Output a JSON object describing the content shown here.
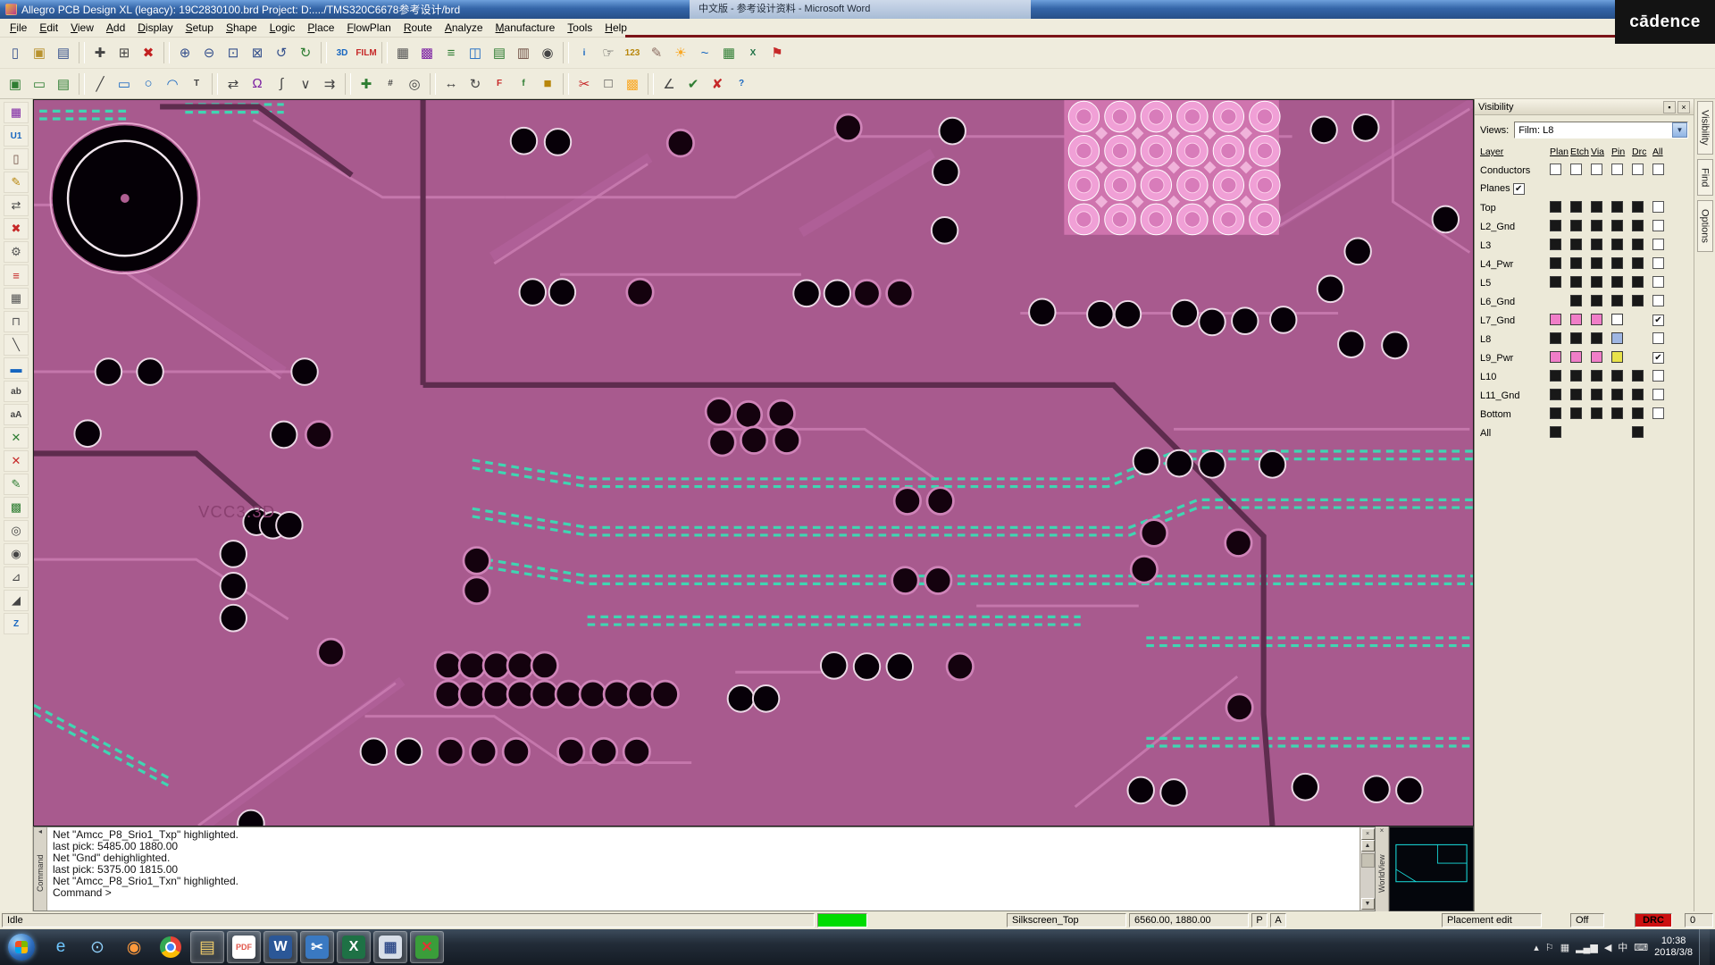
{
  "colors": {
    "canvas_bg": "#a85a8e",
    "teal": "#3fd6b2",
    "trace_light": "#ca7cb2",
    "trace_wide": "#b867a2",
    "trace_dark": "#5e2c4e",
    "pad_black": "#070008",
    "pad_ring_white": "#ecd8e6",
    "pad_ring_purple": "#cf84b8",
    "bga_base": "#cf74ae",
    "bga_pad": "#f0a0d6",
    "bga_inner": "#d87cba",
    "highlight_green": "#00dc00",
    "drc_red": "#cc1111"
  },
  "glyphs": {
    "close": "×",
    "pin": "▪",
    "dropdown": "▼",
    "check": "✔",
    "scroll_up": "▲",
    "scroll_down": "▼",
    "left_arrows": "◂"
  },
  "titlebar": {
    "title": "Allegro PCB Design XL (legacy): 19C2830100.brd  Project: D:..../TMS320C6678参考设计/brd",
    "background_window_title": "中文版 - 参考设计资料 - Microsoft Word",
    "brand_logo": "cādence"
  },
  "menubar": {
    "items": [
      "File",
      "Edit",
      "View",
      "Add",
      "Display",
      "Setup",
      "Shape",
      "Logic",
      "Place",
      "FlowPlan",
      "Route",
      "Analyze",
      "Manufacture",
      "Tools",
      "Help"
    ]
  },
  "toolbar_row1": [
    {
      "name": "new-icon",
      "glyph": "▯",
      "color": "#35508c"
    },
    {
      "name": "open-icon",
      "glyph": "▣",
      "color": "#b8922e"
    },
    {
      "name": "save-icon",
      "glyph": "▤",
      "color": "#35508c"
    },
    {
      "sep": true
    },
    {
      "name": "move-icon",
      "glyph": "✚",
      "color": "#444444"
    },
    {
      "name": "copy-icon",
      "glyph": "⊞",
      "color": "#444444"
    },
    {
      "name": "delete-icon",
      "glyph": "✖",
      "color": "#c22020"
    },
    {
      "sep": true
    },
    {
      "name": "zoom-in-icon",
      "glyph": "⊕",
      "color": "#35508c"
    },
    {
      "name": "zoom-out-icon",
      "glyph": "⊖",
      "color": "#35508c"
    },
    {
      "name": "zoom-by-points-icon",
      "glyph": "⊡",
      "color": "#35508c"
    },
    {
      "name": "zoom-fit-icon",
      "glyph": "⊠",
      "color": "#35508c"
    },
    {
      "name": "zoom-previous-icon",
      "glyph": "↺",
      "color": "#35508c"
    },
    {
      "name": "redraw-icon",
      "glyph": "↻",
      "color": "#2e7d32"
    },
    {
      "sep": true
    },
    {
      "name": "view-3d-icon",
      "glyph": "3D",
      "color": "#1565c0",
      "text": true
    },
    {
      "name": "film-icon",
      "glyph": "FILM",
      "color": "#c62828",
      "text": true
    },
    {
      "sep": true
    },
    {
      "name": "grid-toggle-icon",
      "glyph": "▦",
      "color": "#555555"
    },
    {
      "name": "color-dialog-icon",
      "glyph": "▩",
      "color": "#7b1fa2"
    },
    {
      "name": "cross-section-icon",
      "glyph": "≡",
      "color": "#2e7d32"
    },
    {
      "name": "padstack-icon",
      "glyph": "◫",
      "color": "#1565c0"
    },
    {
      "name": "constraint-mgr-icon",
      "glyph": "▤",
      "color": "#2e7d32"
    },
    {
      "name": "component-icon",
      "glyph": "▥",
      "color": "#6d4c41"
    },
    {
      "name": "pin-icon",
      "glyph": "◉",
      "color": "#444444"
    },
    {
      "sep": true
    },
    {
      "name": "info-icon",
      "glyph": "i",
      "color": "#1565c0",
      "text": true
    },
    {
      "name": "show-element-icon",
      "glyph": "☞",
      "color": "#444444"
    },
    {
      "name": "status-icon",
      "glyph": "123",
      "color": "#b8860b",
      "text": true
    },
    {
      "name": "measure-icon",
      "glyph": "✎",
      "color": "#8d6e63"
    },
    {
      "name": "highlight-icon",
      "glyph": "☀",
      "color": "#f9a825"
    },
    {
      "name": "waveform-icon",
      "glyph": "~",
      "color": "#1565c0"
    },
    {
      "name": "spreadsheet-icon",
      "glyph": "▦",
      "color": "#2e7d32"
    },
    {
      "name": "excel-icon",
      "glyph": "X",
      "color": "#1e7145",
      "text": true
    },
    {
      "name": "flag-icon",
      "glyph": "⚑",
      "color": "#c62828"
    }
  ],
  "toolbar_row2": [
    {
      "name": "board-green-icon",
      "glyph": "▣",
      "color": "#2e7d32"
    },
    {
      "name": "board-outline-icon",
      "glyph": "▭",
      "color": "#2e7d32"
    },
    {
      "name": "board-save-icon",
      "glyph": "▤",
      "color": "#2e7d32"
    },
    {
      "sep": true
    },
    {
      "name": "add-line-icon",
      "glyph": "╱",
      "color": "#444444"
    },
    {
      "name": "add-rect-icon",
      "glyph": "▭",
      "color": "#1565c0"
    },
    {
      "name": "add-circle-icon",
      "glyph": "○",
      "color": "#1565c0"
    },
    {
      "name": "add-arc-icon",
      "glyph": "◠",
      "color": "#1565c0"
    },
    {
      "name": "add-text-icon",
      "glyph": "T",
      "color": "#444444",
      "text": true
    },
    {
      "sep": true
    },
    {
      "name": "slide-icon",
      "glyph": "⇄",
      "color": "#444444"
    },
    {
      "name": "delay-tune-icon",
      "glyph": "Ω",
      "color": "#7b1fa2"
    },
    {
      "name": "custom-smooth-icon",
      "glyph": "∫",
      "color": "#444444"
    },
    {
      "name": "vertex-icon",
      "glyph": "∨",
      "color": "#444444"
    },
    {
      "name": "spread-icon",
      "glyph": "⇉",
      "color": "#444444"
    },
    {
      "sep": true
    },
    {
      "name": "route-connect-icon",
      "glyph": "✚",
      "color": "#2e7d32"
    },
    {
      "name": "fanout-icon",
      "glyph": "#",
      "color": "#444444",
      "text": true
    },
    {
      "name": "add-via-icon",
      "glyph": "◎",
      "color": "#444444"
    },
    {
      "sep": true
    },
    {
      "name": "mirror-icon",
      "glyph": "↔",
      "color": "#444444"
    },
    {
      "name": "spin-icon",
      "glyph": "↻",
      "color": "#444444"
    },
    {
      "name": "fix-icon",
      "glyph": "F",
      "color": "#c62828",
      "text": true
    },
    {
      "name": "unfix-icon",
      "glyph": "f",
      "color": "#2e7d32",
      "text": true
    },
    {
      "name": "lock-icon",
      "glyph": "■",
      "color": "#b8860b"
    },
    {
      "sep": true
    },
    {
      "name": "ripup-icon",
      "glyph": "✂",
      "color": "#c62828"
    },
    {
      "name": "dehighlight-icon",
      "glyph": "□",
      "color": "#444444"
    },
    {
      "name": "assign-color-icon",
      "glyph": "▩",
      "color": "#f9a825"
    },
    {
      "sep": true
    },
    {
      "name": "measure-angle-icon",
      "glyph": "∠",
      "color": "#444444"
    },
    {
      "name": "done-icon",
      "glyph": "✔",
      "color": "#2e7d32"
    },
    {
      "name": "cancel-icon",
      "glyph": "✘",
      "color": "#c62828"
    },
    {
      "name": "help-icon",
      "glyph": "?",
      "color": "#1565c0",
      "text": true
    }
  ],
  "left_toolbar": [
    {
      "name": "design-icon",
      "glyph": "▦",
      "color": "#7b1fa2"
    },
    {
      "name": "place-part-icon",
      "glyph": "U1",
      "color": "#1565c0",
      "text": true
    },
    {
      "name": "place-module-icon",
      "glyph": "▯",
      "color": "#6d4c41"
    },
    {
      "name": "etch-edit-icon",
      "glyph": "✎",
      "color": "#b8860b"
    },
    {
      "name": "slide-tool-icon",
      "glyph": "⇄",
      "color": "#444444"
    },
    {
      "name": "delete-tool-icon",
      "glyph": "✖",
      "color": "#c62828"
    },
    {
      "name": "wrench-icon",
      "glyph": "⚙",
      "color": "#555555"
    },
    {
      "name": "list-icon",
      "glyph": "≡",
      "color": "#c62828"
    },
    {
      "name": "grid-icon",
      "glyph": "▦",
      "color": "#555555"
    },
    {
      "name": "clamp-icon",
      "glyph": "⊓",
      "color": "#555555"
    },
    {
      "name": "line-tool-icon",
      "glyph": "╲",
      "color": "#444444"
    },
    {
      "name": "rect-tool-icon",
      "glyph": "▬",
      "color": "#1565c0"
    },
    {
      "name": "text-tool-icon",
      "glyph": "ab",
      "color": "#444444",
      "text": true
    },
    {
      "name": "label-tool-icon",
      "glyph": "aA",
      "color": "#444444",
      "text": true
    },
    {
      "name": "route-green-icon",
      "glyph": "✕",
      "color": "#2e7d32"
    },
    {
      "name": "route-red-icon",
      "glyph": "✕",
      "color": "#c62828"
    },
    {
      "name": "gloss-icon",
      "glyph": "✎",
      "color": "#2e7d32"
    },
    {
      "name": "shape-icon",
      "glyph": "▩",
      "color": "#2e7d32"
    },
    {
      "name": "via-tool-icon",
      "glyph": "◎",
      "color": "#444444"
    },
    {
      "name": "pin-tool-icon",
      "glyph": "◉",
      "color": "#444444"
    },
    {
      "name": "dimension-icon",
      "glyph": "⊿",
      "color": "#444444"
    },
    {
      "name": "chamfer-icon",
      "glyph": "◢",
      "color": "#444444"
    },
    {
      "name": "zcopy-icon",
      "glyph": "Z",
      "color": "#1565c0",
      "text": true
    }
  ],
  "canvas": {
    "net_label": "VCC3.3D"
  },
  "visibility_panel": {
    "title": "Visibility",
    "views_label": "Views:",
    "views_value": "Film: L8",
    "layer_header": "Layer",
    "columns": [
      "Plan",
      "Etch",
      "Via",
      "Pin",
      "Drc",
      "All"
    ],
    "conductors_label": "Conductors",
    "planes_label": "Planes",
    "planes_checked": true,
    "cell_colors": {
      "dark": "#181818",
      "pink": "#f07ec8",
      "yellow": "#e8e24a",
      "lightblue": "#9fb6e2",
      "white": "#ffffff"
    },
    "rows": [
      {
        "label": "Top",
        "cells": [
          "dark",
          "dark",
          "dark",
          "dark",
          "dark"
        ],
        "all": "unchecked"
      },
      {
        "label": "L2_Gnd",
        "cells": [
          "dark",
          "dark",
          "dark",
          "dark",
          "dark"
        ],
        "all": "unchecked"
      },
      {
        "label": "L3",
        "cells": [
          "dark",
          "dark",
          "dark",
          "dark",
          "dark"
        ],
        "all": "unchecked"
      },
      {
        "label": "L4_Pwr",
        "cells": [
          "dark",
          "dark",
          "dark",
          "dark",
          "dark"
        ],
        "all": "unchecked"
      },
      {
        "label": "L5",
        "cells": [
          "dark",
          "dark",
          "dark",
          "dark",
          "dark"
        ],
        "all": "unchecked"
      },
      {
        "label": "L6_Gnd",
        "cells": [
          null,
          "dark",
          "dark",
          "dark",
          "dark"
        ],
        "all": "unchecked"
      },
      {
        "label": "L7_Gnd",
        "cells": [
          "pink",
          "pink",
          "pink",
          "white",
          null
        ],
        "all": "checked"
      },
      {
        "label": "L8",
        "cells": [
          "dark",
          "dark",
          "dark",
          "lightblue",
          null
        ],
        "all": "unchecked"
      },
      {
        "label": "L9_Pwr",
        "cells": [
          "pink",
          "pink",
          "pink",
          "yellow",
          null
        ],
        "all": "checked"
      },
      {
        "label": "L10",
        "cells": [
          "dark",
          "dark",
          "dark",
          "dark",
          "dark"
        ],
        "all": "unchecked"
      },
      {
        "label": "L11_Gnd",
        "cells": [
          "dark",
          "dark",
          "dark",
          "dark",
          "dark"
        ],
        "all": "unchecked"
      },
      {
        "label": "Bottom",
        "cells": [
          "dark",
          "dark",
          "dark",
          "dark",
          "dark"
        ],
        "all": "unchecked"
      },
      {
        "label": "All",
        "cells": [
          "dark",
          null,
          null,
          null,
          "dark"
        ],
        "all": null
      }
    ]
  },
  "edge_tabs": [
    "Visibility",
    "Find",
    "Options"
  ],
  "console": {
    "tab": "Command",
    "lines": [
      "Net \"Amcc_P8_Srio1_Txp\" highlighted.",
      "last pick:  5485.00  1880.00",
      "Net \"Gnd\" dehighlighted.",
      "last pick:  5375.00  1815.00",
      "Net \"Amcc_P8_Srio1_Txn\" highlighted.",
      "Command >"
    ]
  },
  "worldview": {
    "tab": "WorldView"
  },
  "statusbar": {
    "state": "Idle",
    "film": "Silkscreen_Top",
    "coords": "6560.00, 1880.00",
    "p": "P",
    "a": "A",
    "mode": "Placement edit",
    "off": "Off",
    "drc": "DRC",
    "drc_count": "0"
  },
  "taskbar": {
    "icons": [
      {
        "name": "taskbar-ie-icon",
        "glyph": "e",
        "bg": "",
        "color": "#6ec6ff",
        "running": false
      },
      {
        "name": "taskbar-browser-icon",
        "glyph": "⊙",
        "bg": "",
        "color": "#8ecdf7",
        "running": false
      },
      {
        "name": "taskbar-firefox-icon",
        "glyph": "◉",
        "bg": "",
        "color": "#ff9a3d",
        "running": false
      },
      {
        "name": "taskbar-chrome-icon",
        "glyph": "",
        "bg": "chrome",
        "color": "",
        "running": false
      },
      {
        "name": "taskbar-folder-icon",
        "glyph": "▤",
        "bg": "",
        "color": "#f3cf6b",
        "running": true
      },
      {
        "name": "taskbar-pdf-icon",
        "glyph": "PDF",
        "bg": "#ffffff",
        "color": "#e2574c",
        "running": true
      },
      {
        "name": "taskbar-word-icon",
        "glyph": "W",
        "bg": "#2b5797",
        "color": "#ffffff",
        "running": true
      },
      {
        "name": "taskbar-snip-icon",
        "glyph": "✂",
        "bg": "#3a79c2",
        "color": "#ffffff",
        "running": true
      },
      {
        "name": "taskbar-excel-icon",
        "glyph": "X",
        "bg": "#1e7145",
        "color": "#ffffff",
        "running": true
      },
      {
        "name": "taskbar-calc-icon",
        "glyph": "▦",
        "bg": "#d7dee8",
        "color": "#35508c",
        "running": true
      },
      {
        "name": "taskbar-allegro-icon",
        "glyph": "✕",
        "bg": "#3a9d3a",
        "color": "#e23333",
        "running": true
      }
    ],
    "tray_icons": [
      "▴",
      "⚐",
      "▦",
      "▂▄▆",
      "◀"
    ],
    "lang": "中",
    "kbd": "⌨",
    "time": "10:38",
    "date": "2018/3/8"
  }
}
